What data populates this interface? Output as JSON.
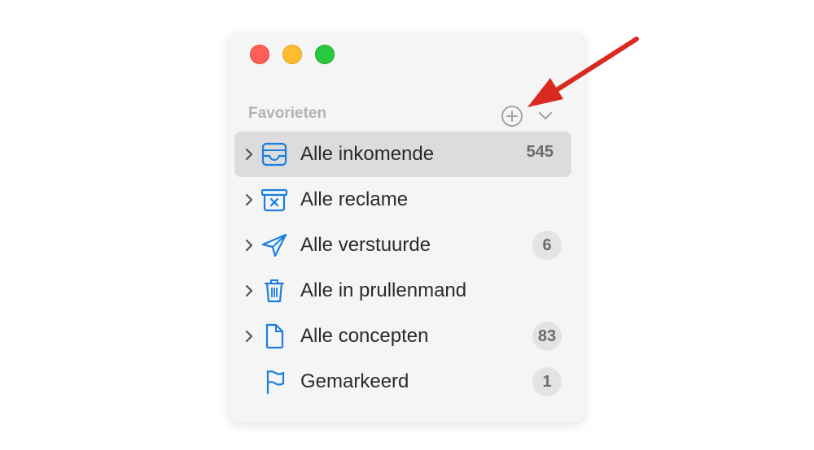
{
  "colors": {
    "accent": "#1a7fe0",
    "arrow": "#d92a20",
    "window_bg": "#f5f5f5",
    "selected_row": "#dcdcdc",
    "badge_bg": "#e3e3e3"
  },
  "window": {
    "traffic_lights": [
      "close",
      "minimize",
      "zoom"
    ]
  },
  "sidebar": {
    "section_title": "Favorieten",
    "add_icon": "plus-circle-icon",
    "collapse_icon": "chevron-down-icon",
    "items": [
      {
        "label": "Alle inkomende",
        "count": "545",
        "icon": "inbox-tray-icon",
        "selected": true,
        "expandable": true
      },
      {
        "label": "Alle reclame",
        "count": "",
        "icon": "junk-box-icon",
        "selected": false,
        "expandable": true
      },
      {
        "label": "Alle verstuurde",
        "count": "6",
        "icon": "paper-plane-icon",
        "selected": false,
        "expandable": true
      },
      {
        "label": "Alle in prullenmand",
        "count": "",
        "icon": "trash-icon",
        "selected": false,
        "expandable": true
      },
      {
        "label": "Alle concepten",
        "count": "83",
        "icon": "document-icon",
        "selected": false,
        "expandable": true
      },
      {
        "label": "Gemarkeerd",
        "count": "1",
        "icon": "flag-icon",
        "selected": false,
        "expandable": false
      }
    ]
  },
  "annotation": {
    "arrow_icon": "red-arrow-icon"
  }
}
